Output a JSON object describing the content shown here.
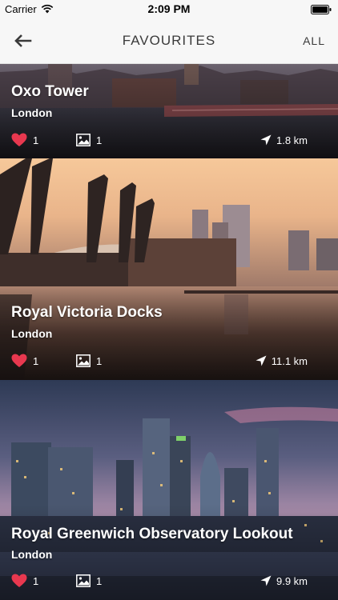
{
  "status_bar": {
    "carrier": "Carrier",
    "time": "2:09 PM"
  },
  "nav": {
    "title": "FAVOURITES",
    "all_label": "ALL"
  },
  "favourites": [
    {
      "name": "Oxo Tower",
      "city": "London",
      "likes": "1",
      "photos": "1",
      "distance": "1.8 km"
    },
    {
      "name": "Royal Victoria Docks",
      "city": "London",
      "likes": "1",
      "photos": "1",
      "distance": "11.1 km"
    },
    {
      "name": "Royal Greenwich Observatory Lookout",
      "city": "London",
      "likes": "1",
      "photos": "1",
      "distance": "9.9 km"
    }
  ],
  "colors": {
    "heart": "#e8384f",
    "nav_bg": "#f7f7f7",
    "text_dark": "#3a3a3a"
  },
  "icons": {
    "back": "arrow-left-icon",
    "like": "heart-icon",
    "photos": "image-icon",
    "distance": "location-arrow-icon"
  }
}
